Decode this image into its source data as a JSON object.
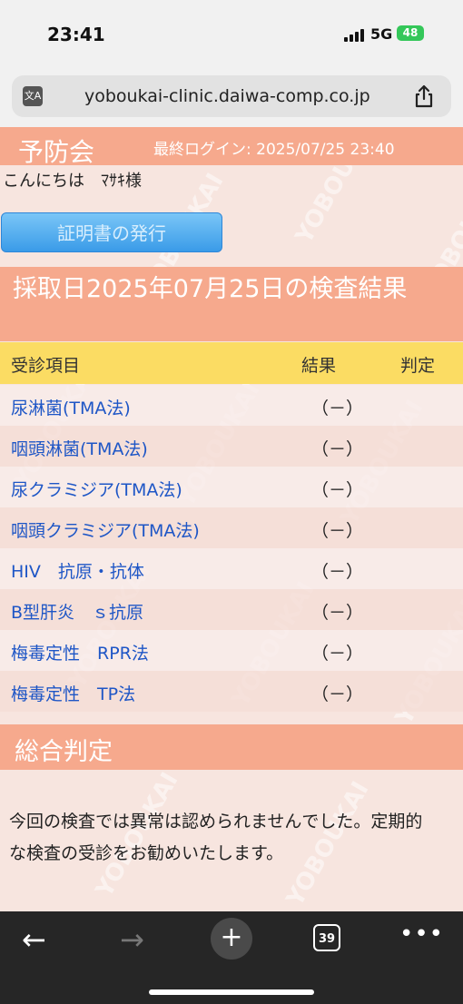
{
  "status_bar": {
    "time": "23:41",
    "network": "5G",
    "battery": "48"
  },
  "browser": {
    "url": "yoboukai-clinic.daiwa-comp.co.jp",
    "tab_count": "39"
  },
  "page": {
    "logo": "予防会",
    "last_login": "最終ログイン: 2025/07/25 23:40",
    "greeting": "こんにちは　ﾏｻｷ様",
    "certificate_button": "証明書の発行",
    "results_title": "採取日2025年07月25日の検査結果",
    "table": {
      "headers": [
        "受診項目",
        "結果",
        "判定"
      ],
      "rows": [
        {
          "item": "尿淋菌(TMA法)",
          "result": "（－）",
          "judgment": ""
        },
        {
          "item": "咽頭淋菌(TMA法)",
          "result": "（－）",
          "judgment": ""
        },
        {
          "item": "尿クラミジア(TMA法)",
          "result": "（－）",
          "judgment": ""
        },
        {
          "item": "咽頭クラミジア(TMA法)",
          "result": "（－）",
          "judgment": ""
        },
        {
          "item": "HIV　抗原・抗体",
          "result": "（－）",
          "judgment": ""
        },
        {
          "item": "B型肝炎　ｓ抗原",
          "result": "（－）",
          "judgment": ""
        },
        {
          "item": "梅毒定性　RPR法",
          "result": "（－）",
          "judgment": ""
        },
        {
          "item": "梅毒定性　TP法",
          "result": "（－）",
          "judgment": ""
        }
      ]
    },
    "overall_title": "総合判定",
    "overall_text": "今回の検査では異常は認められませんでした。定期的な検査の受診をお勧めいたします。",
    "watermark": "YOBOUKAI"
  },
  "colors": {
    "accent": "#f6a98d",
    "header_yellow": "#fbdc63",
    "link_blue": "#1e56c6",
    "button_blue": "#3a9be8"
  }
}
